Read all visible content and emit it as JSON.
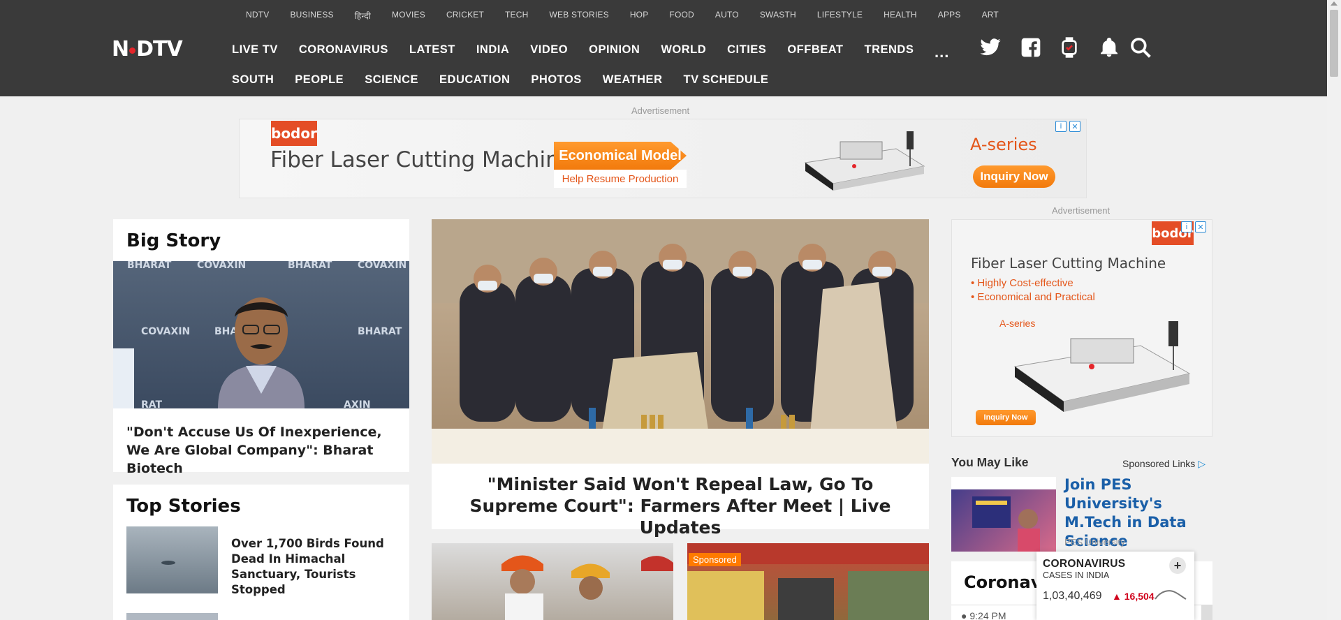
{
  "header": {
    "logo_text": "NDTV",
    "top_nav": [
      "NDTV",
      "BUSINESS",
      "हिन्दी",
      "MOVIES",
      "CRICKET",
      "TECH",
      "WEB STORIES",
      "HOP",
      "FOOD",
      "AUTO",
      "SWASTH",
      "LIFESTYLE",
      "HEALTH",
      "APPS",
      "ART"
    ],
    "main_nav": [
      "LIVE TV",
      "CORONAVIRUS",
      "LATEST",
      "INDIA",
      "VIDEO",
      "OPINION",
      "WORLD",
      "CITIES",
      "OFFBEAT",
      "TRENDS"
    ],
    "sub_nav": [
      "SOUTH",
      "PEOPLE",
      "SCIENCE",
      "EDUCATION",
      "PHOTOS",
      "WEATHER",
      "TV SCHEDULE"
    ],
    "more_label": "...",
    "icons": [
      "twitter-icon",
      "facebook-icon",
      "watch-icon",
      "bell-icon",
      "search-icon"
    ]
  },
  "ads": {
    "label": "Advertisement",
    "top": {
      "brand": "bodor",
      "title": "Fiber Laser Cutting Machine",
      "highlight": "Economical Model",
      "sub": "Help Resume Production",
      "series": "A-series",
      "cta": "Inquiry Now"
    },
    "side": {
      "brand": "bodor",
      "title": "Fiber Laser Cutting Machine",
      "bullets": [
        "Highly Cost-effective",
        "Economical and Practical"
      ],
      "series": "A-series",
      "cta": "Inquiry Now"
    }
  },
  "big_story": {
    "title": "Big Story",
    "headline": "\"Don't Accuse Us Of Inexperience, We Are Global Company\": Bharat Biotech"
  },
  "lead_story": {
    "headline": "\"Minister Said Won't Repeal Law, Go To Supreme Court\": Farmers After Meet | Live Updates"
  },
  "top_stories": {
    "title": "Top Stories",
    "items": [
      {
        "headline": "Over 1,700 Birds Found Dead In Himachal Sanctuary, Tourists Stopped"
      }
    ]
  },
  "sponsored_label": "Sponsored",
  "you_may_like": {
    "title": "You May Like",
    "sponsored_links": "Sponsored Links",
    "item_title": "Join PES University's M.Tech in Data Science",
    "item_source": "PES University"
  },
  "coronavirus": {
    "card_title": "Coronavi",
    "time": "9:24 PM",
    "widget_title": "CORONAVIRUS",
    "widget_sub": "CASES IN INDIA",
    "cases": "1,03,40,469",
    "delta": "16,504",
    "plus": "+"
  }
}
